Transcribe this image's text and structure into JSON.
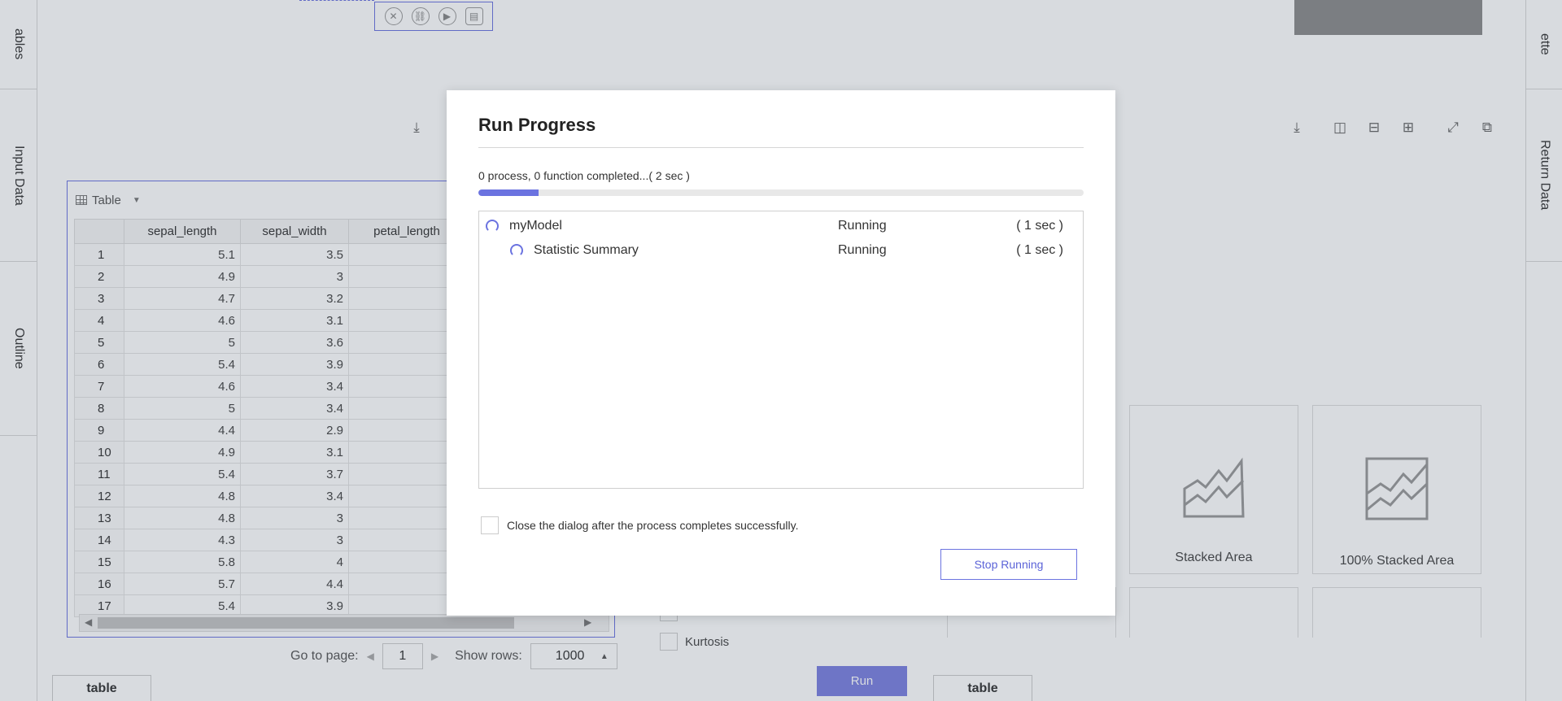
{
  "left_rail": {
    "tabs": [
      {
        "label": "ables"
      },
      {
        "label": "Input Data"
      },
      {
        "label": "Outline"
      }
    ]
  },
  "right_rail": {
    "tabs": [
      {
        "label": "ette"
      },
      {
        "label": "Return Data"
      }
    ]
  },
  "table_widget": {
    "view_label": "Table",
    "columns": [
      "sepal_length",
      "sepal_width",
      "petal_length"
    ],
    "rows": [
      {
        "idx": "1",
        "sepal_length": "5.1",
        "sepal_width": "3.5"
      },
      {
        "idx": "2",
        "sepal_length": "4.9",
        "sepal_width": "3"
      },
      {
        "idx": "3",
        "sepal_length": "4.7",
        "sepal_width": "3.2"
      },
      {
        "idx": "4",
        "sepal_length": "4.6",
        "sepal_width": "3.1"
      },
      {
        "idx": "5",
        "sepal_length": "5",
        "sepal_width": "3.6"
      },
      {
        "idx": "6",
        "sepal_length": "5.4",
        "sepal_width": "3.9"
      },
      {
        "idx": "7",
        "sepal_length": "4.6",
        "sepal_width": "3.4"
      },
      {
        "idx": "8",
        "sepal_length": "5",
        "sepal_width": "3.4"
      },
      {
        "idx": "9",
        "sepal_length": "4.4",
        "sepal_width": "2.9"
      },
      {
        "idx": "10",
        "sepal_length": "4.9",
        "sepal_width": "3.1"
      },
      {
        "idx": "11",
        "sepal_length": "5.4",
        "sepal_width": "3.7"
      },
      {
        "idx": "12",
        "sepal_length": "4.8",
        "sepal_width": "3.4"
      },
      {
        "idx": "13",
        "sepal_length": "4.8",
        "sepal_width": "3"
      },
      {
        "idx": "14",
        "sepal_length": "4.3",
        "sepal_width": "3"
      },
      {
        "idx": "15",
        "sepal_length": "5.8",
        "sepal_width": "4"
      },
      {
        "idx": "16",
        "sepal_length": "5.7",
        "sepal_width": "4.4"
      },
      {
        "idx": "17",
        "sepal_length": "5.4",
        "sepal_width": "3.9"
      }
    ]
  },
  "pager": {
    "goto_label": "Go to page:",
    "page_value": "1",
    "show_rows_label": "Show rows:",
    "rows_value": "1000"
  },
  "bottom_tabs": {
    "left": "table",
    "right": "table"
  },
  "chart_types": [
    {
      "label": "Stacked Area",
      "icon": "stacked-area-icon"
    },
    {
      "label": "100% Stacked Area",
      "icon": "percent-stacked-area-icon"
    }
  ],
  "stat_options": {
    "kurtosis_label": "Kurtosis",
    "run_label": "Run"
  },
  "dialog": {
    "title": "Run Progress",
    "status_text": "0 process, 0 function completed...( 2 sec )",
    "progress_fraction": 0.1,
    "processes": [
      {
        "name": "myModel",
        "state": "Running",
        "duration": "( 1 sec )",
        "level": 0
      },
      {
        "name": "Statistic Summary",
        "state": "Running",
        "duration": "( 1 sec )",
        "level": 1
      }
    ],
    "close_after_label": "Close the dialog after the process completes successfully.",
    "close_after_checked": false,
    "stop_label": "Stop Running",
    "accent_color": "#6b73e0"
  }
}
